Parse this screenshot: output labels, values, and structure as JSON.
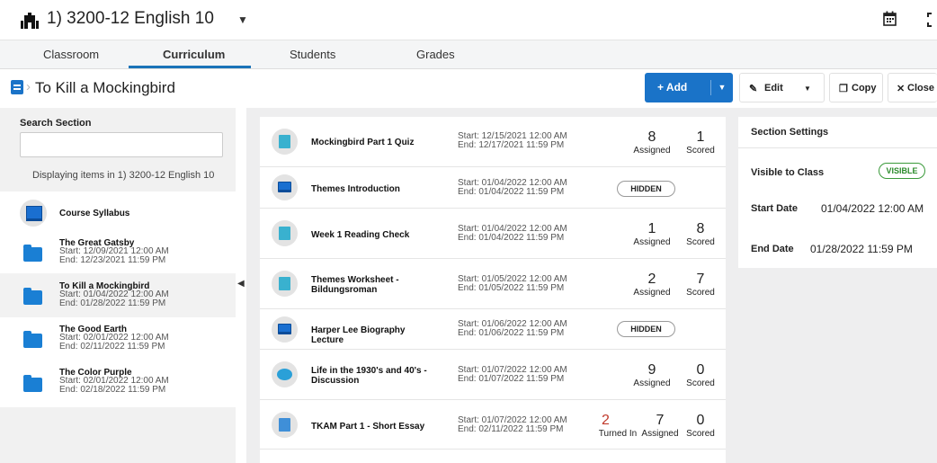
{
  "header": {
    "course_title": "1) 3200-12 English 10"
  },
  "tabs": [
    "Classroom",
    "Curriculum",
    "Students",
    "Grades"
  ],
  "breadcrumb": {
    "title": "To Kill a Mockingbird"
  },
  "toolbar": {
    "add": "+ Add",
    "edit": "Edit",
    "copy": "Copy",
    "close": "Close"
  },
  "sidebar": {
    "search_label": "Search Section",
    "search_value": "",
    "display_text": "Displaying items in 1) 3200-12 English 10",
    "items": [
      {
        "title": "Course Syllabus"
      },
      {
        "title": "The Great Gatsby",
        "start": "Start: 12/09/2021 12:00 AM",
        "end": "End: 12/23/2021 11:59 PM"
      },
      {
        "title": "To Kill a Mockingbird",
        "start": "Start: 01/04/2022 12:00 AM",
        "end": "End: 01/28/2022 11:59 PM"
      },
      {
        "title": "The Good Earth",
        "start": "Start: 02/01/2022 12:00 AM",
        "end": "End: 02/11/2022 11:59 PM"
      },
      {
        "title": "The Color Purple",
        "start": "Start: 02/01/2022 12:00 AM",
        "end": "End: 02/18/2022 11:59 PM"
      }
    ]
  },
  "rows": [
    {
      "title": "Mockingbird Part 1 Quiz",
      "start": "Start: 12/15/2021 12:00 AM",
      "end": "End: 12/17/2021 11:59 PM",
      "assigned": "8",
      "scored": "1"
    },
    {
      "title": "Themes Introduction",
      "start": "Start: 01/04/2022 12:00 AM",
      "end": "End: 01/04/2022 11:59 PM",
      "badge": "HIDDEN"
    },
    {
      "title": "Week 1 Reading Check",
      "start": "Start: 01/04/2022 12:00 AM",
      "end": "End: 01/04/2022 11:59 PM",
      "assigned": "1",
      "scored": "8"
    },
    {
      "title": "Themes Worksheet - Bildungsroman",
      "start": "Start: 01/05/2022 12:00 AM",
      "end": "End: 01/05/2022 11:59 PM",
      "assigned": "2",
      "scored": "7"
    },
    {
      "title": "Harper Lee Biography Lecture",
      "start": "Start: 01/06/2022 12:00 AM",
      "end": "End: 01/06/2022 11:59 PM",
      "badge": "HIDDEN"
    },
    {
      "title": "Life in the 1930's and 40's - Discussion",
      "start": "Start: 01/07/2022 12:00 AM",
      "end": "End: 01/07/2022 11:59 PM",
      "assigned": "9",
      "scored": "0"
    },
    {
      "title": "TKAM Part 1 - Short Essay",
      "start": "Start: 01/07/2022 12:00 AM",
      "end": "End: 02/11/2022 11:59 PM",
      "turned_in": "2",
      "assigned": "7",
      "scored": "0"
    }
  ],
  "labels": {
    "assigned": "Assigned",
    "scored": "Scored",
    "turned_in": "Turned In"
  },
  "settings": {
    "title": "Section Settings",
    "visible_label": "Visible to Class",
    "visible_badge": "VISIBLE",
    "start_label": "Start Date",
    "start_value": "01/04/2022 12:00 AM",
    "end_label": "End Date",
    "end_value": "01/28/2022 11:59 PM"
  }
}
